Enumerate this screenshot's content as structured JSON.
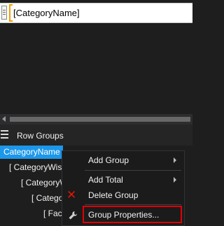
{
  "designer": {
    "cell_value": "[CategoryName]"
  },
  "row_groups": {
    "title": "Row Groups",
    "items": [
      {
        "label": "CategoryName",
        "selected": true
      },
      {
        "label": "[ CategoryWise"
      },
      {
        "label": "[ CategoryW"
      },
      {
        "label": "[ Catego"
      },
      {
        "label": "[ Fact"
      }
    ]
  },
  "context_menu": {
    "items": [
      {
        "label": "Add Group",
        "submenu": true
      },
      {
        "label": "Add Total",
        "submenu": true
      },
      {
        "label": "Delete Group",
        "icon": "delete-x-icon"
      },
      {
        "label": "Group Properties...",
        "icon": "wrench-icon",
        "highlighted": true
      }
    ]
  },
  "colors": {
    "background": "#1e1e1e",
    "selection": "#1c97ea",
    "highlight_border": "#e00000",
    "delete_icon": "#e51400",
    "cell_border": "#f0a000"
  }
}
